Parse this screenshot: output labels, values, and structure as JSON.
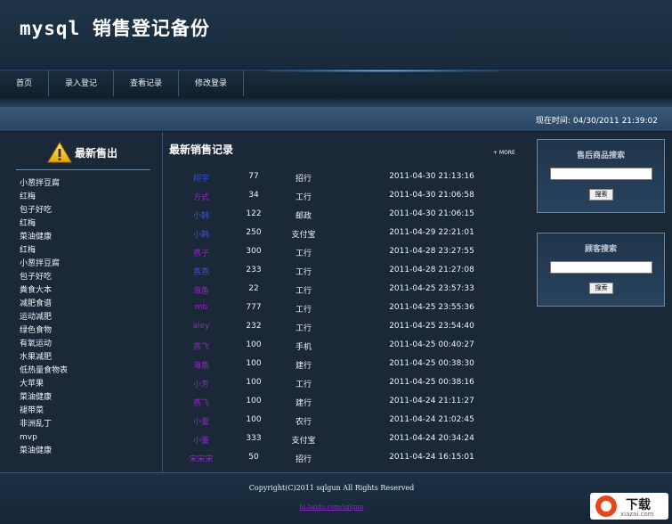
{
  "header": {
    "title": "mysql 销售登记备份"
  },
  "nav": {
    "items": [
      "首页",
      "录入登记",
      "查看记录",
      "修改登录"
    ]
  },
  "time": {
    "label": "现在时间:",
    "value": "04/30/2011 21:39:02"
  },
  "sidebar": {
    "title": "最新售出",
    "icon": "warning-icon",
    "items": [
      "小葱拌豆腐",
      "红梅",
      "包子好吃",
      "红梅",
      "菜油健康",
      "红梅",
      "小葱拌豆腐",
      "包子好吃",
      "粪食大本",
      "减肥食谱",
      "运动减肥",
      "绿色食物",
      "有氧运动",
      "水果减肥",
      "低热量食物表",
      "大苹果",
      "菜油健康",
      "褪带菜",
      "非洲乱丁",
      "mvp",
      "菜油健康"
    ]
  },
  "main": {
    "title": "最新销售记录",
    "more": "+ MORE",
    "records": [
      {
        "name": "翔宇",
        "qty": "77",
        "product": "招行",
        "time": "2011-04-30 21:13:16",
        "color": "#3a4fd8"
      },
      {
        "name": "方式",
        "qty": "34",
        "product": "工行",
        "time": "2011-04-30 21:06:58",
        "color": "#8a2bbf"
      },
      {
        "name": "小韩",
        "qty": "122",
        "product": "邮政",
        "time": "2011-04-30 21:06:15",
        "color": "#3a4fd8"
      },
      {
        "name": "小韩",
        "qty": "250",
        "product": "支付宝",
        "time": "2011-04-29 22:21:01",
        "color": "#3a4fd8"
      },
      {
        "name": "燕子",
        "qty": "300",
        "product": "工行",
        "time": "2011-04-28 23:27:55",
        "color": "#8a2bbf"
      },
      {
        "name": "燕燕",
        "qty": "233",
        "product": "工行",
        "time": "2011-04-28 21:27:08",
        "color": "#3a4fd8"
      },
      {
        "name": "海鱼",
        "qty": "22",
        "product": "工行",
        "time": "2011-04-25 23:57:33",
        "color": "#8a2bbf"
      },
      {
        "name": "mb",
        "qty": "777",
        "product": "工行",
        "time": "2011-04-25 23:55:36",
        "color": "#8a2bbf"
      },
      {
        "name": "aley",
        "qty": "232",
        "product": "工行",
        "time": "2011-04-25 23:54:40",
        "color": "#8a2bbf"
      },
      {
        "name": "燕飞",
        "qty": "100",
        "product": "手机",
        "time": "2011-04-25 00:40:27",
        "color": "#8a2bbf"
      },
      {
        "name": "海鱼",
        "qty": "100",
        "product": "建行",
        "time": "2011-04-25 00:38:30",
        "color": "#8a2bbf"
      },
      {
        "name": "小芳",
        "qty": "100",
        "product": "工行",
        "time": "2011-04-25 00:38:16",
        "color": "#8a2bbf"
      },
      {
        "name": "燕飞",
        "qty": "100",
        "product": "建行",
        "time": "2011-04-24 21:11:27",
        "color": "#8a2bbf"
      },
      {
        "name": "小董",
        "qty": "100",
        "product": "农行",
        "time": "2011-04-24 21:02:45",
        "color": "#8a2bbf"
      },
      {
        "name": "小董",
        "qty": "333",
        "product": "支付宝",
        "time": "2011-04-24 20:34:24",
        "color": "#8a2bbf"
      },
      {
        "name": "宋宋宋",
        "qty": "50",
        "product": "招行",
        "time": "2011-04-24 16:15:01",
        "color": "#8a2bbf"
      }
    ]
  },
  "search": {
    "product": {
      "title": "售后商品搜索",
      "button": "搜索",
      "value": ""
    },
    "customer": {
      "title": "顾客搜索",
      "button": "搜索",
      "value": ""
    }
  },
  "footer": {
    "copyright": "Copyright(C)2011 sqlgun All Rights Reserved",
    "link": "hi.baidu.com/sqlgun"
  },
  "watermark": {
    "text": "下载",
    "sub": "xiazai.com"
  }
}
